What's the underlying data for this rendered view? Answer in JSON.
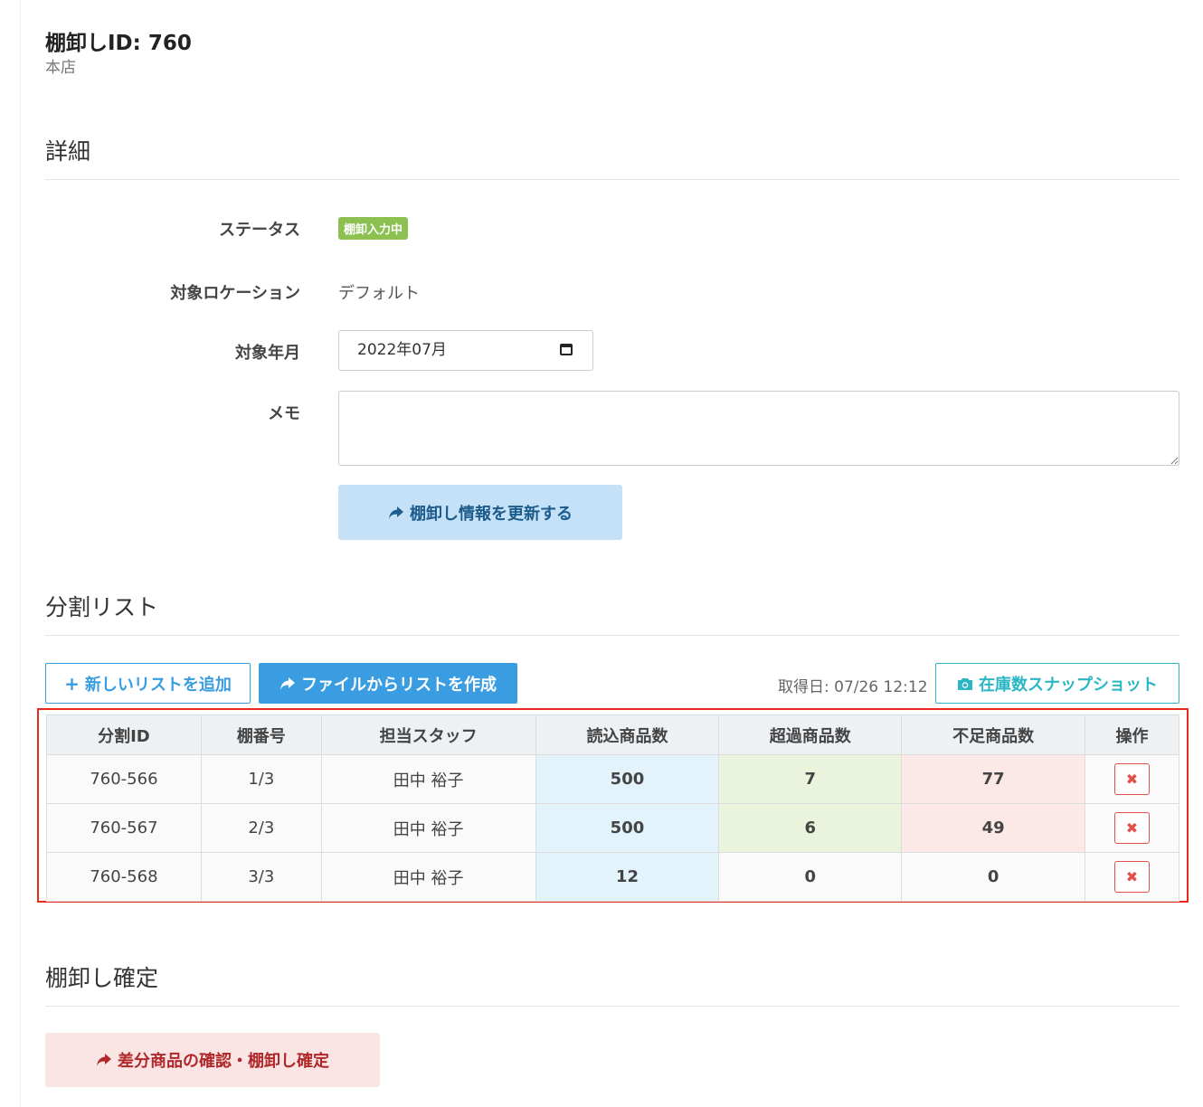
{
  "header": {
    "title": "棚卸しID: 760",
    "store": "本店"
  },
  "details": {
    "heading": "詳細",
    "status_label": "ステータス",
    "status_value": "棚卸入力中",
    "location_label": "対象ロケーション",
    "location_value": "デフォルト",
    "month_label": "対象年月",
    "month_value": "2022年07月",
    "memo_label": "メモ",
    "memo_value": "",
    "update_button": "棚卸し情報を更新する"
  },
  "split_list": {
    "heading": "分割リスト",
    "add_button": "新しいリストを追加",
    "file_button": "ファイルからリストを作成",
    "fetch_date": "取得日: 07/26 12:12",
    "snapshot_button": "在庫数スナップショット",
    "columns": [
      "分割ID",
      "棚番号",
      "担当スタッフ",
      "読込商品数",
      "超過商品数",
      "不足商品数",
      "操作"
    ],
    "rows": [
      {
        "id": "760-566",
        "shelf": "1/3",
        "staff": "田中 裕子",
        "read": "500",
        "over": "7",
        "short": "77"
      },
      {
        "id": "760-567",
        "shelf": "2/3",
        "staff": "田中 裕子",
        "read": "500",
        "over": "6",
        "short": "49"
      },
      {
        "id": "760-568",
        "shelf": "3/3",
        "staff": "田中 裕子",
        "read": "12",
        "over": "0",
        "short": "0"
      }
    ],
    "delete_icon": "✖"
  },
  "confirm": {
    "heading": "棚卸し確定",
    "button": "差分商品の確認・棚卸し確定"
  },
  "colors": {
    "primary": "#3a9de2",
    "info": "#2ab6c4",
    "success": "#8cc152",
    "danger": "#e4504b",
    "highlight": "#e8291c"
  }
}
